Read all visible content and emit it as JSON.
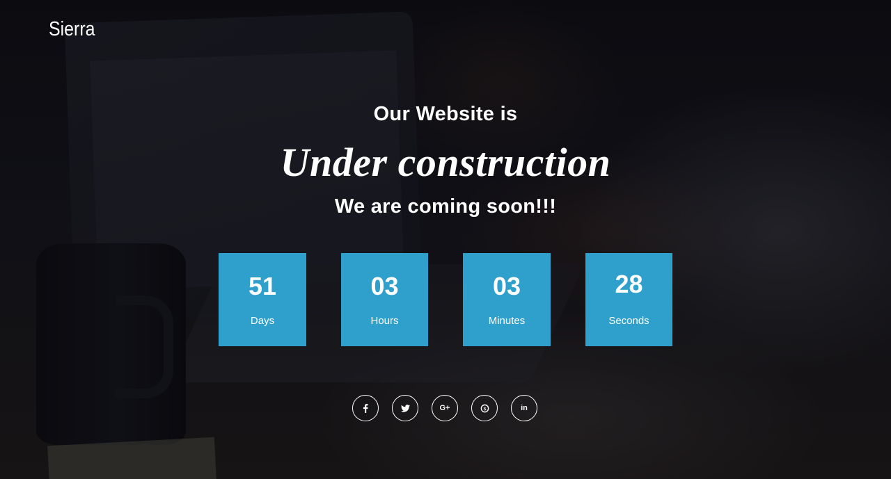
{
  "brand": {
    "name": "Sierra"
  },
  "hero": {
    "intro": "Our Website is",
    "headline": "Under construction",
    "tagline": "We are coming soon!!!"
  },
  "countdown": [
    {
      "value": "51",
      "label": "Days"
    },
    {
      "value": "03",
      "label": "Hours"
    },
    {
      "value": "03",
      "label": "Minutes"
    },
    {
      "value": "28",
      "label": "Seconds"
    }
  ],
  "social": [
    {
      "icon": "facebook-icon"
    },
    {
      "icon": "twitter-icon"
    },
    {
      "icon": "google-plus-icon",
      "glyph": "G+"
    },
    {
      "icon": "skype-icon"
    },
    {
      "icon": "linkedin-icon",
      "glyph": "in"
    }
  ],
  "colors": {
    "countdown_box": "#2fa0cc",
    "text": "#ffffff"
  }
}
